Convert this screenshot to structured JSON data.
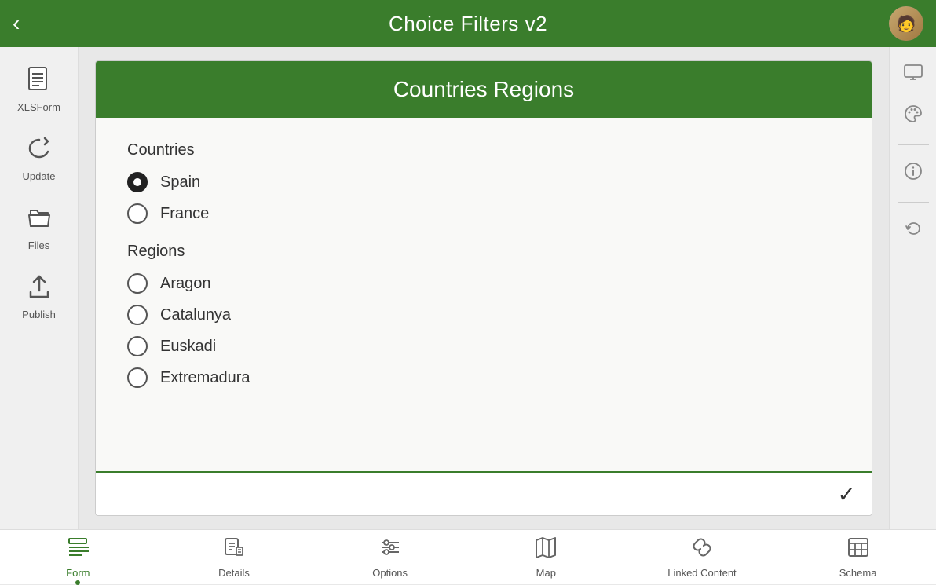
{
  "app": {
    "title": "Choice Filters v2"
  },
  "top_bar": {
    "back_label": "‹",
    "title": "Choice Filters v2"
  },
  "left_sidebar": {
    "items": [
      {
        "id": "xlsform",
        "label": "XLSForm",
        "icon": "xlsform"
      },
      {
        "id": "update",
        "label": "Update",
        "icon": "update"
      },
      {
        "id": "files",
        "label": "Files",
        "icon": "files"
      },
      {
        "id": "publish",
        "label": "Publish",
        "icon": "publish"
      }
    ]
  },
  "form_card": {
    "title": "Countries Regions",
    "countries_label": "Countries",
    "countries": [
      {
        "id": "spain",
        "label": "Spain",
        "selected": true
      },
      {
        "id": "france",
        "label": "France",
        "selected": false
      }
    ],
    "regions_label": "Regions",
    "regions": [
      {
        "id": "aragon",
        "label": "Aragon",
        "selected": false
      },
      {
        "id": "catalunya",
        "label": "Catalunya",
        "selected": false
      },
      {
        "id": "euskadi",
        "label": "Euskadi",
        "selected": false
      },
      {
        "id": "extremadura",
        "label": "Extremadura",
        "selected": false
      }
    ],
    "checkmark": "✓"
  },
  "right_sidebar": {
    "icons": [
      "monitor",
      "palette",
      "info",
      "undo"
    ]
  },
  "bottom_bar": {
    "tabs": [
      {
        "id": "form",
        "label": "Form",
        "active": true
      },
      {
        "id": "details",
        "label": "Details",
        "active": false
      },
      {
        "id": "options",
        "label": "Options",
        "active": false
      },
      {
        "id": "map",
        "label": "Map",
        "active": false
      },
      {
        "id": "linked-content",
        "label": "Linked Content",
        "active": false
      },
      {
        "id": "schema",
        "label": "Schema",
        "active": false
      }
    ]
  },
  "colors": {
    "green": "#3a7d2c"
  }
}
